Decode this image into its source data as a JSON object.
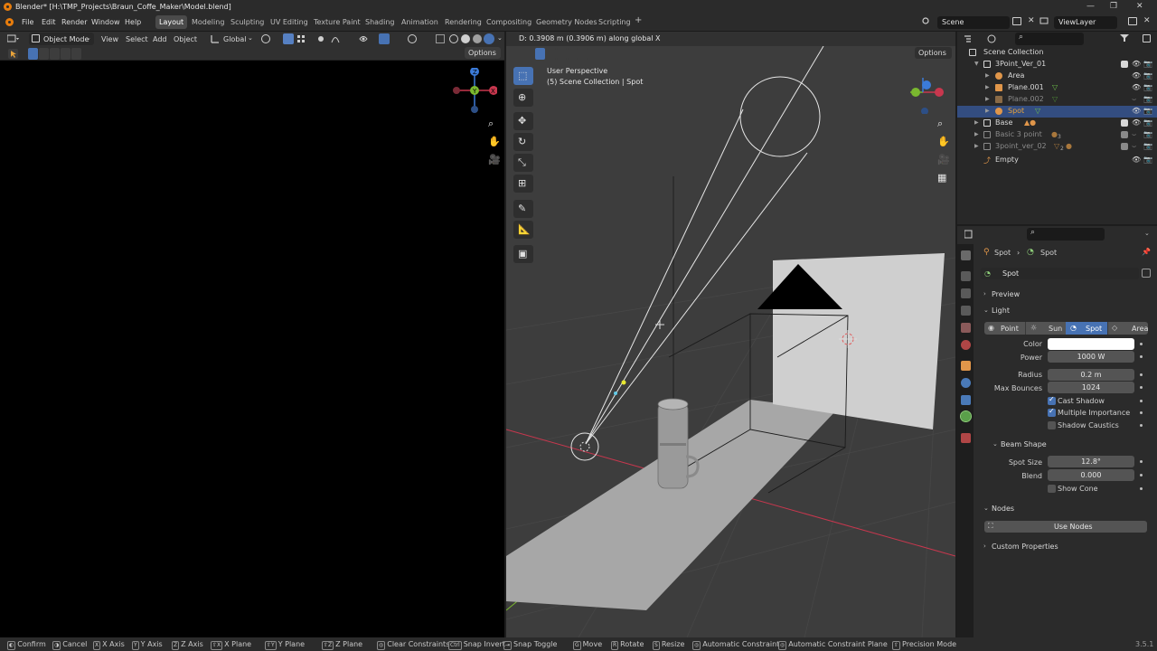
{
  "titlebar": {
    "title": "Blender* [H:\\TMP_Projects\\Braun_Coffe_Maker\\Model.blend]",
    "minimize": "—",
    "maximize": "❐",
    "close": "✕"
  },
  "menu": {
    "items": [
      "File",
      "Edit",
      "Render",
      "Window",
      "Help"
    ],
    "workspaces": [
      "Layout",
      "Modeling",
      "Sculpting",
      "UV Editing",
      "Texture Paint",
      "Shading",
      "Animation",
      "Rendering",
      "Compositing",
      "Geometry Nodes",
      "Scripting"
    ],
    "active_workspace": "Layout",
    "add_workspace": "+",
    "scene": "Scene",
    "view_layer": "ViewLayer"
  },
  "left_editor": {
    "mode": "Object Mode",
    "menus": [
      "View",
      "Select",
      "Add",
      "Object"
    ],
    "transform_orientation": "Global",
    "options": "Options"
  },
  "viewport": {
    "header_status": "D: 0.3908 m (0.3906 m) along global X",
    "options": "Options",
    "view_name": "User Perspective",
    "context": "(5) Scene Collection | Spot",
    "gizmo": {
      "x": "X",
      "y": "Y",
      "z": "Z"
    },
    "colors": {
      "x_axis": "#c8374e",
      "y_axis": "#7ab82f",
      "z_axis": "#3b7bd9",
      "light_line": "#e6e6e6"
    }
  },
  "outliner": {
    "search_placeholder": "",
    "root": "Scene Collection",
    "rows": [
      {
        "name": "3Point_Ver_01",
        "dim": false
      },
      {
        "name": "Area",
        "dim": false
      },
      {
        "name": "Plane.001",
        "dim": false
      },
      {
        "name": "Plane.002",
        "dim": true
      },
      {
        "name": "Spot",
        "dim": false,
        "selected": true
      },
      {
        "name": "Base",
        "dim": false
      },
      {
        "name": "Basic 3 point",
        "dim": true
      },
      {
        "name": "3point_ver_02",
        "dim": true
      },
      {
        "name": "Empty",
        "dim": false
      }
    ],
    "badges": {
      "basic_3_point": "3",
      "point_ver_02": "2"
    }
  },
  "properties": {
    "breadcrumb_obj": "Spot",
    "breadcrumb_data": "Spot",
    "data_name": "Spot",
    "sections": {
      "preview": "Preview",
      "light": "Light",
      "beam_shape": "Beam Shape",
      "nodes": "Nodes",
      "custom_properties": "Custom Properties"
    },
    "light_types": [
      "Point",
      "Sun",
      "Spot",
      "Area"
    ],
    "active_light_type": "Spot",
    "fields": {
      "color_label": "Color",
      "color_value": "#ffffff",
      "power_label": "Power",
      "power_value": "1000 W",
      "radius_label": "Radius",
      "radius_value": "0.2 m",
      "max_bounces_label": "Max Bounces",
      "max_bounces_value": "1024",
      "spot_size_label": "Spot Size",
      "spot_size_value": "12.8°",
      "blend_label": "Blend",
      "blend_value": "0.000"
    },
    "checks": {
      "cast_shadow": "Cast Shadow",
      "multiple_importance": "Multiple Importance",
      "shadow_caustics": "Shadow Caustics",
      "show_cone": "Show Cone"
    },
    "use_nodes": "Use Nodes"
  },
  "statusbar": {
    "items": [
      {
        "key": "",
        "label": "Confirm"
      },
      {
        "key": "",
        "label": "Cancel"
      },
      {
        "key": "X",
        "label": "X Axis"
      },
      {
        "key": "Y",
        "label": "Y Axis"
      },
      {
        "key": "Z",
        "label": "Z Axis"
      },
      {
        "key": "⇧X",
        "label": "X Plane"
      },
      {
        "key": "⇧Y",
        "label": "Y Plane"
      },
      {
        "key": "⇧Z",
        "label": "Z Plane"
      },
      {
        "key": "",
        "label": "Clear Constraints"
      },
      {
        "key": "Ctrl",
        "label": "Snap Invert"
      },
      {
        "key": "⇥",
        "label": "Snap Toggle"
      },
      {
        "key": "G",
        "label": "Move"
      },
      {
        "key": "R",
        "label": "Rotate"
      },
      {
        "key": "S",
        "label": "Resize"
      },
      {
        "key": "",
        "label": "Automatic Constraint"
      },
      {
        "key": "",
        "label": "Automatic Constraint Plane"
      },
      {
        "key": "",
        "label": "Precision Mode"
      }
    ],
    "version": "3.5.1"
  }
}
